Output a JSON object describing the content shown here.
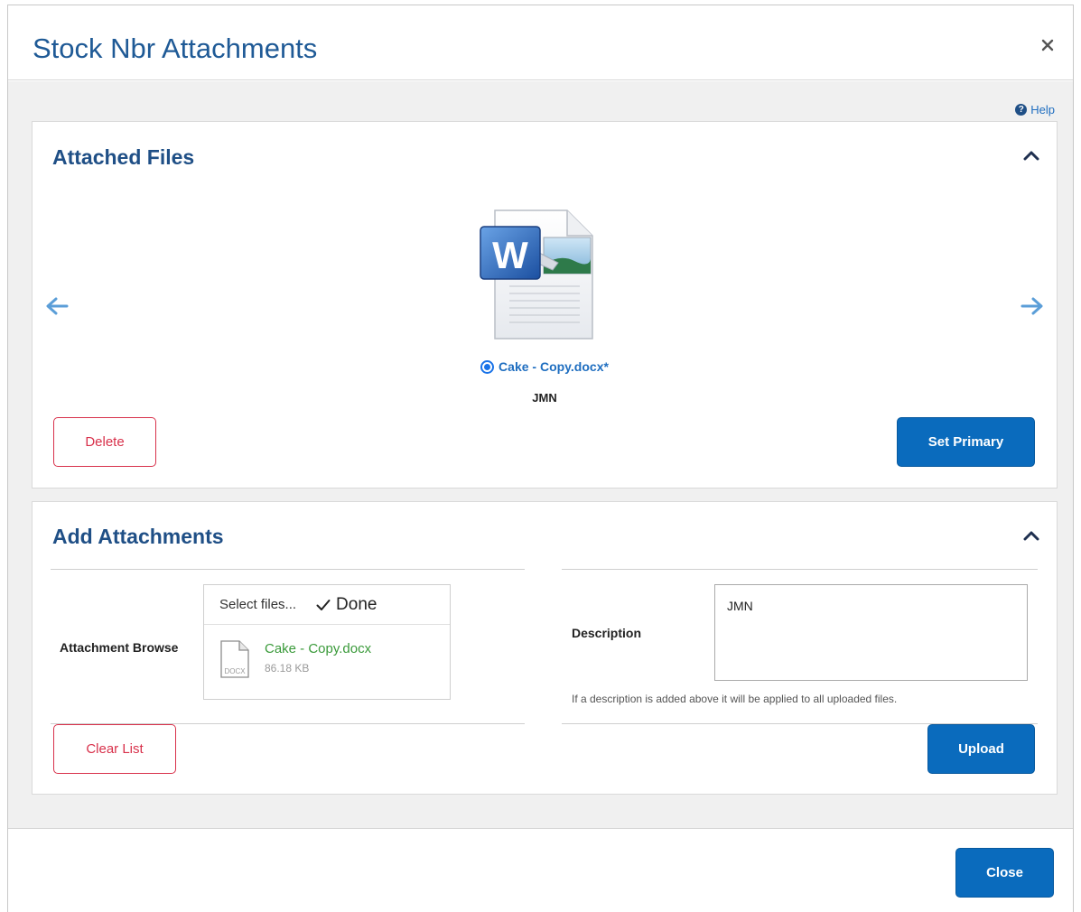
{
  "modal": {
    "title": "Stock Nbr Attachments",
    "close_icon": "close-icon"
  },
  "help": {
    "label": "Help",
    "icon": "help-circle-icon"
  },
  "attached_files": {
    "title": "Attached Files",
    "file": {
      "name": "Cake - Copy.docx*",
      "description": "JMN",
      "icon": "word-document-icon",
      "selected": true
    },
    "prev_icon": "arrow-left-icon",
    "next_icon": "arrow-right-icon",
    "delete_label": "Delete",
    "set_primary_label": "Set Primary"
  },
  "add_attachments": {
    "title": "Add Attachments",
    "browse_label": "Attachment Browse",
    "select_files_label": "Select files...",
    "done_label": "Done",
    "upload_file": {
      "name": "Cake - Copy.docx",
      "size": "86.18 KB",
      "ext": "DOCX"
    },
    "description_label": "Description",
    "description_value": "JMN",
    "description_hint": "If a description is added above it will be applied to all uploaded files.",
    "clear_list_label": "Clear List",
    "upload_label": "Upload"
  },
  "footer": {
    "close_label": "Close"
  },
  "colors": {
    "accent": "#0a6bbd",
    "title": "#1f4f86",
    "danger": "#d8314b",
    "success": "#3a9a3a"
  }
}
